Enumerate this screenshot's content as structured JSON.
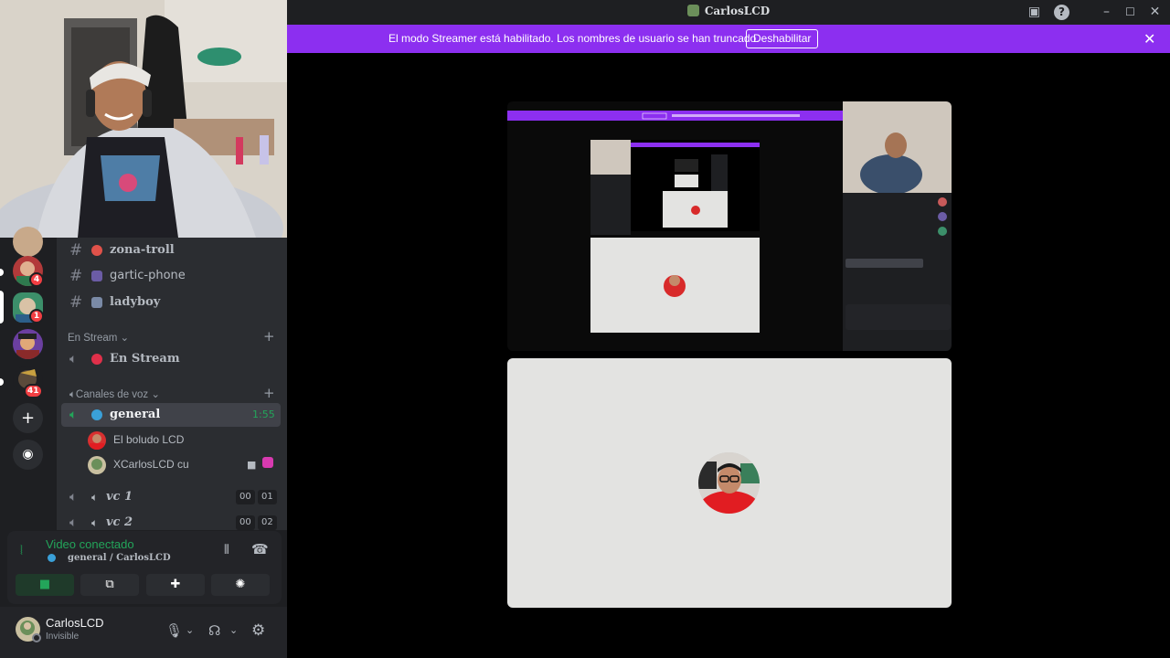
{
  "window": {
    "title": "CarlosLCD",
    "controls": [
      "inbox",
      "help",
      "minimize",
      "maximize",
      "close"
    ]
  },
  "banner": {
    "text": "El modo Streamer está habilitado. Los nombres de usuario se han truncado.",
    "button_label": "Deshabilitar",
    "close_glyph": "✕"
  },
  "channels": {
    "text_channels": [
      {
        "name": "zona-troll",
        "emoji_color": "#e0524a"
      },
      {
        "name": "gartic-phone",
        "emoji_color": "#6b5ca5"
      },
      {
        "name": "ladyboy",
        "emoji_color": "#7a8aa6"
      }
    ],
    "categories": [
      {
        "label": "En Stream"
      },
      {
        "label": "Canales de voz"
      }
    ],
    "stream_channel": {
      "name": "En Stream"
    },
    "voice_channels": [
      {
        "name": "general",
        "timer": "1:55"
      },
      {
        "name": "vc 1",
        "count_current": "00",
        "count_limit": "01"
      },
      {
        "name": "vc 2",
        "count_current": "00",
        "count_limit": "02"
      }
    ],
    "voice_users": [
      {
        "name": "El boludo LCD"
      },
      {
        "name": "XCarlosLCD cu"
      }
    ]
  },
  "servers": {
    "badges": [
      "4",
      "1",
      "41"
    ]
  },
  "voice_panel": {
    "status": "Video conectado",
    "location": "general / CarlosLCD",
    "accent": "#23a55a"
  },
  "user_panel": {
    "username": "CarlosLCD",
    "status": "Invisible"
  },
  "colors": {
    "banner": "#8c2ff0",
    "connected_green": "#23a55a",
    "background": "#1e1f22",
    "sidebar": "#2b2d31"
  }
}
